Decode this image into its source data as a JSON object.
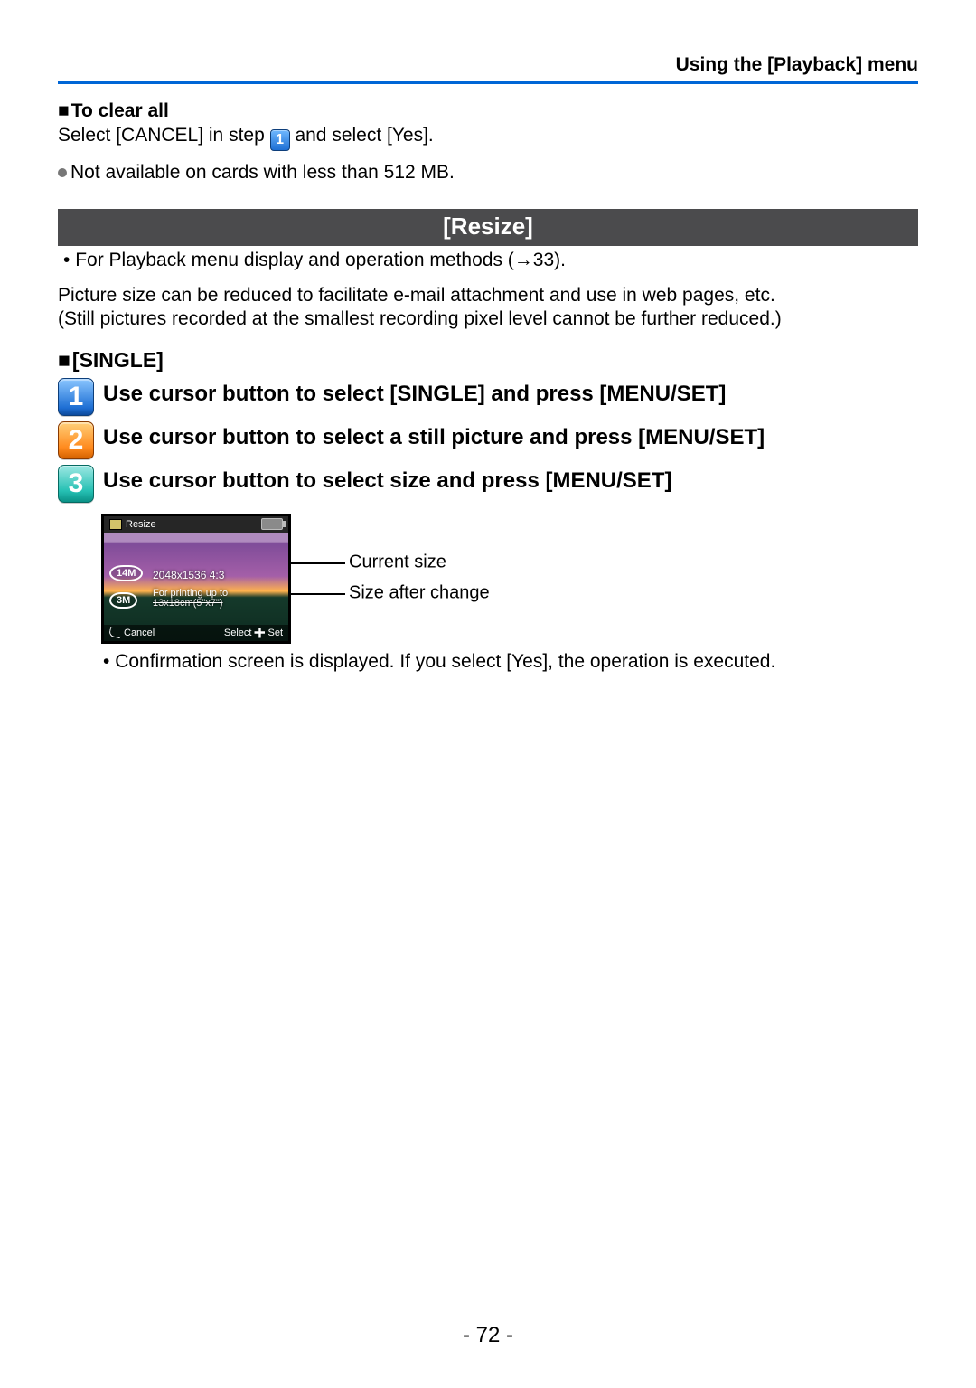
{
  "header": {
    "breadcrumb": "Using the [Playback] menu"
  },
  "clearAll": {
    "title": "To clear all",
    "text_before": "Select [CANCEL] in step ",
    "step_ref": "1",
    "text_after": " and select [Yes].",
    "note": "Not available on cards with less than 512 MB."
  },
  "section": {
    "title": "[Resize]"
  },
  "xref": {
    "text": "For Playback menu display and operation methods (→33)."
  },
  "description": {
    "line1": "Picture size can be reduced to facilitate e-mail attachment and use in web pages, etc.",
    "line2": "(Still pictures recorded at the smallest recording pixel level cannot be further reduced.)"
  },
  "mode": {
    "title": "[SINGLE]"
  },
  "steps": {
    "s1": "Use cursor button to select [SINGLE] and press [MENU/SET]",
    "s2": "Use cursor button to select a still picture and press [MENU/SET]",
    "s3": "Use cursor button to select size and press [MENU/SET]"
  },
  "lcd": {
    "title": "Resize",
    "badge14": "14M",
    "badge3": "3M",
    "dimensions": "2048x1536 4:3",
    "print_line1": "For printing up to",
    "print_line2": "13x18cm(5\"x7\")",
    "cancel": "Cancel",
    "select": "Select",
    "set": "Set"
  },
  "callouts": {
    "current": "Current size",
    "after": "Size after change"
  },
  "post_note": "Confirmation screen is displayed. If you select [Yes], the operation is executed.",
  "page_number": "- 72 -"
}
